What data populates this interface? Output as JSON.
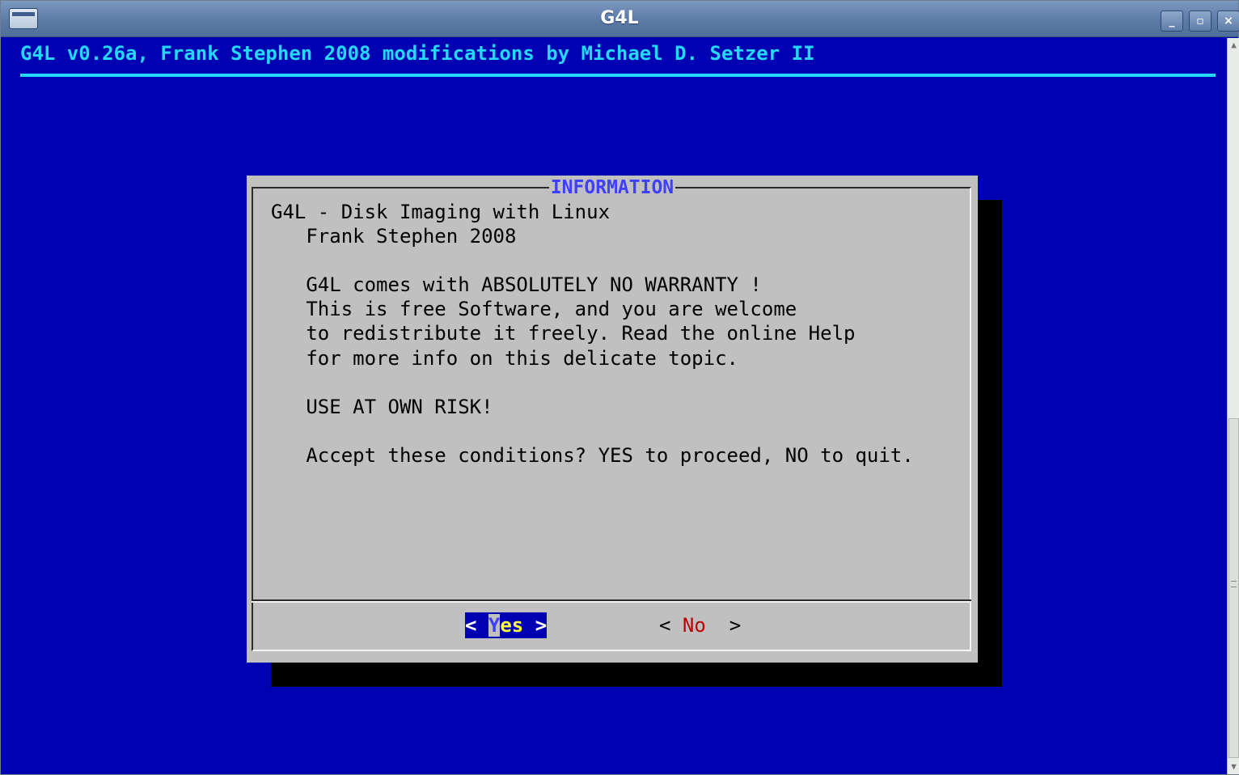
{
  "window": {
    "title": "G4L",
    "minimize_glyph": "_",
    "maximize_glyph": "▫",
    "close_glyph": "×"
  },
  "terminal": {
    "backtitle": "G4L v0.26a, Frank Stephen 2008 modifications by Michael D. Setzer II"
  },
  "dialog": {
    "title": "INFORMATION",
    "text": "G4L - Disk Imaging with Linux\n   Frank Stephen 2008\n\n   G4L comes with ABSOLUTELY NO WARRANTY !\n   This is free Software, and you are welcome\n   to redistribute it freely. Read the online Help\n   for more info on this delicate topic.\n\n   USE AT OWN RISK!\n\n   Accept these conditions? YES to proceed, NO to quit.",
    "yes_button": {
      "left": "< ",
      "hotkey": "Y",
      "rest": "es",
      "right": " >"
    },
    "no_button": {
      "left": "< ",
      "hotkey": "N",
      "rest": "o",
      "right": "  >"
    }
  },
  "colors": {
    "terminal_bg": "#0000b3",
    "backtitle": "#24d8ff",
    "dialog_bg": "#c0c0c0",
    "dialog_title": "#3f3fff",
    "no_hotkey": "#c00000",
    "yes_hotkey": "#ffff3c"
  }
}
